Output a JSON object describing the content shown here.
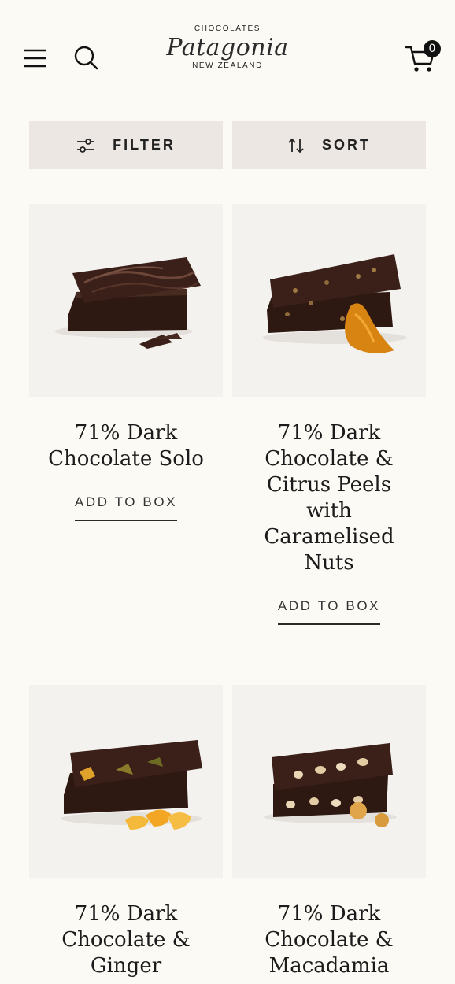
{
  "header": {
    "logo": {
      "top": "CHOCOLATES",
      "script": "Patagonia",
      "bottom": "NEW ZEALAND"
    },
    "cart_count": "0",
    "icons": [
      "menu-icon",
      "search-icon",
      "cart-icon"
    ]
  },
  "controls": {
    "filter_label": "FILTER",
    "sort_label": "SORT",
    "icons": [
      "sliders-icon",
      "sort-arrows-icon"
    ]
  },
  "products": [
    {
      "name_lines": [
        "71% Dark",
        "Chocolate Solo"
      ],
      "cta": "ADD TO BOX"
    },
    {
      "name_lines": [
        "71% Dark",
        "Chocolate &",
        "Citrus Peels",
        "with",
        "Caramelised",
        "Nuts"
      ],
      "cta": "ADD TO BOX"
    },
    {
      "name_lines": [
        "71% Dark",
        "Chocolate &",
        "Ginger"
      ]
    },
    {
      "name_lines": [
        "71% Dark",
        "Chocolate &",
        "Macadamia"
      ]
    }
  ],
  "colors": {
    "background": "#fcfaf5",
    "control_bg": "#ece7e3",
    "chocolate": "#3a2018",
    "text": "#1c1c1c"
  }
}
